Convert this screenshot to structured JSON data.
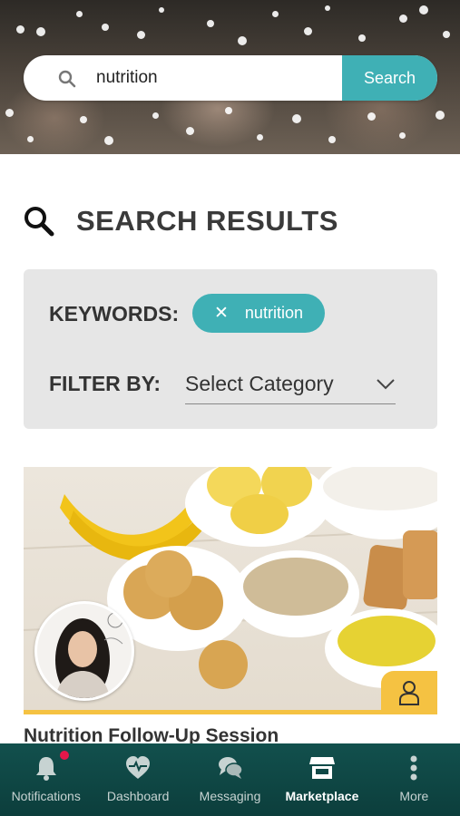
{
  "search": {
    "value": "nutrition",
    "button_label": "Search"
  },
  "results": {
    "title": "SEARCH RESULTS",
    "keywords_label": "KEYWORDS:",
    "keyword_chip": {
      "remove_glyph": "✕",
      "label": "nutrition"
    },
    "filter_label": "FILTER BY:",
    "category_select": {
      "value": "Select Category"
    }
  },
  "card": {
    "title": "Nutrition Follow-Up Session",
    "badge_icon": "user-outline-icon"
  },
  "bottom_nav": {
    "items": [
      {
        "label": "Notifications",
        "icon": "bell-icon",
        "has_alert": true
      },
      {
        "label": "Dashboard",
        "icon": "heart-pulse-icon"
      },
      {
        "label": "Messaging",
        "icon": "chat-bubbles-icon"
      },
      {
        "label": "Marketplace",
        "icon": "storefront-icon",
        "active": true
      },
      {
        "label": "More",
        "icon": "more-vertical-icon"
      }
    ]
  },
  "colors": {
    "accent": "#3fb0b5",
    "highlight": "#f5c242",
    "nav_background": "#0f4846",
    "alert": "#e4174a"
  }
}
